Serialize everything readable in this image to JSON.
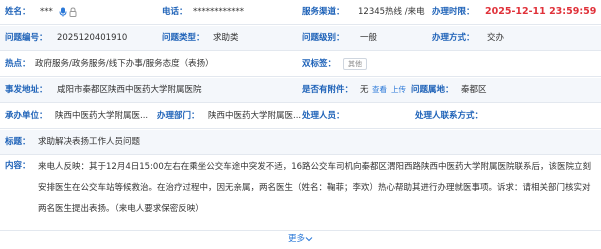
{
  "row1": {
    "name_label": "姓名：",
    "name_value": "***",
    "phone_label": "电话：",
    "phone_value": "************",
    "channel_label": "服务渠道：",
    "channel_value": "12345热线 /来电",
    "time_label": "办理时限：",
    "time_value": "2025-12-11 23:59:59"
  },
  "row2": {
    "id_label": "问题编号：",
    "id_value": "2025120401910",
    "type_label": "问题类型：",
    "type_value": "求助类",
    "level_label": "问题级别：",
    "level_value": "一般",
    "method_label": "办理方式：",
    "method_value": "交办"
  },
  "row3": {
    "hot_label": "热点：",
    "hot_value": "政府服务/政务服务/线下办事/服务态度（表扬）",
    "dual_label": "双标签：",
    "dual_tag": "其他"
  },
  "row4": {
    "location_label": "事发地址：",
    "location_value": "咸阳市秦都区陕西中医药大学附属医院",
    "attach_label": "是否有附件：",
    "attach_value": "无",
    "view_link": "查看",
    "upload_link": "上传",
    "area_label": "问题属地：",
    "area_value": "秦都区"
  },
  "row5": {
    "unit_label": "承办单位：",
    "unit_value": "陕西中医药大学附属医...",
    "dept_label": "办理部门：",
    "dept_value": "陕西中医药大学附属医...",
    "handler_label": "处理人员：",
    "contact_label": "处理人联系方式："
  },
  "row6": {
    "title_label": "标题：",
    "title_value": "求助解决表扬工作人员问题"
  },
  "content": {
    "label": "内容：",
    "text": "来电人反映：其于12月4日15:00左右在乘坐公交车途中突发不适，16路公交车司机向秦都区渭阳西路陕西中医药大学附属医院联系后，该医院立刻安排医生在公交车站等候救治。在治疗过程中，因无亲属，两名医生（姓名：鞠菲；李欢）热心帮助其进行办理就医事项。诉求：请相关部门核实对两名医生提出表扬。（来电人要求保密反映）"
  },
  "more_label": "更多",
  "colors": {
    "label": "#1e62b8",
    "deadline": "#e0323a",
    "link": "#2a78d8"
  }
}
